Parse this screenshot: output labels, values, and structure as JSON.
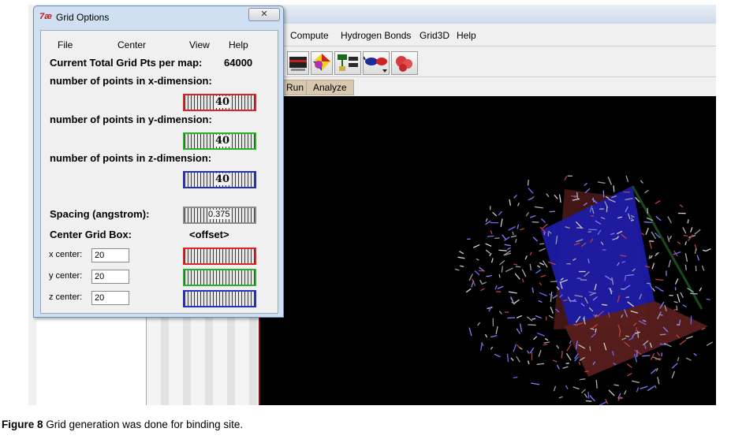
{
  "dialog": {
    "title": "Grid Options",
    "title_icon": "7æ",
    "close_glyph": "✕",
    "menu": [
      "File",
      "Center",
      "View",
      "Help"
    ],
    "total_label": "Current Total Grid Pts per map:",
    "total_value": "64000",
    "x_dim_label": "number of points in x-dimension:",
    "y_dim_label": "number of points in y-dimension:",
    "z_dim_label": "number of points in z-dimension:",
    "x_points": "40",
    "y_points": "40",
    "z_points": "40",
    "spacing_label": "Spacing (angstrom):",
    "spacing_value": "0.375",
    "center_label": "Center Grid Box:",
    "offset_label": "<offset>",
    "x_center_label": "x center:",
    "y_center_label": "y center:",
    "z_center_label": "z center:",
    "x_center_value": "20",
    "y_center_value": "20",
    "z_center_value": "20",
    "colors": {
      "x": "#e02424",
      "y": "#22b522",
      "z": "#2330c0",
      "spacing": "#8a8a8a"
    }
  },
  "main_menu": [
    "Compute",
    "Hydrogen Bonds",
    "Grid3D",
    "Help"
  ],
  "tabs": [
    "Run",
    "Analyze"
  ],
  "toolbar_icons": [
    "display-icon",
    "color-shapes-icon",
    "molecule-settings-icon",
    "stereo-glasses-icon",
    "molecule-surface-icon"
  ],
  "viewer": {
    "background": "#000000",
    "grid_box_colors": [
      "#2a2aa8",
      "#6a1a1a",
      "#1a5a1a"
    ]
  },
  "caption": {
    "label": "Figure 8",
    "text": " Grid generation was done for binding site."
  }
}
